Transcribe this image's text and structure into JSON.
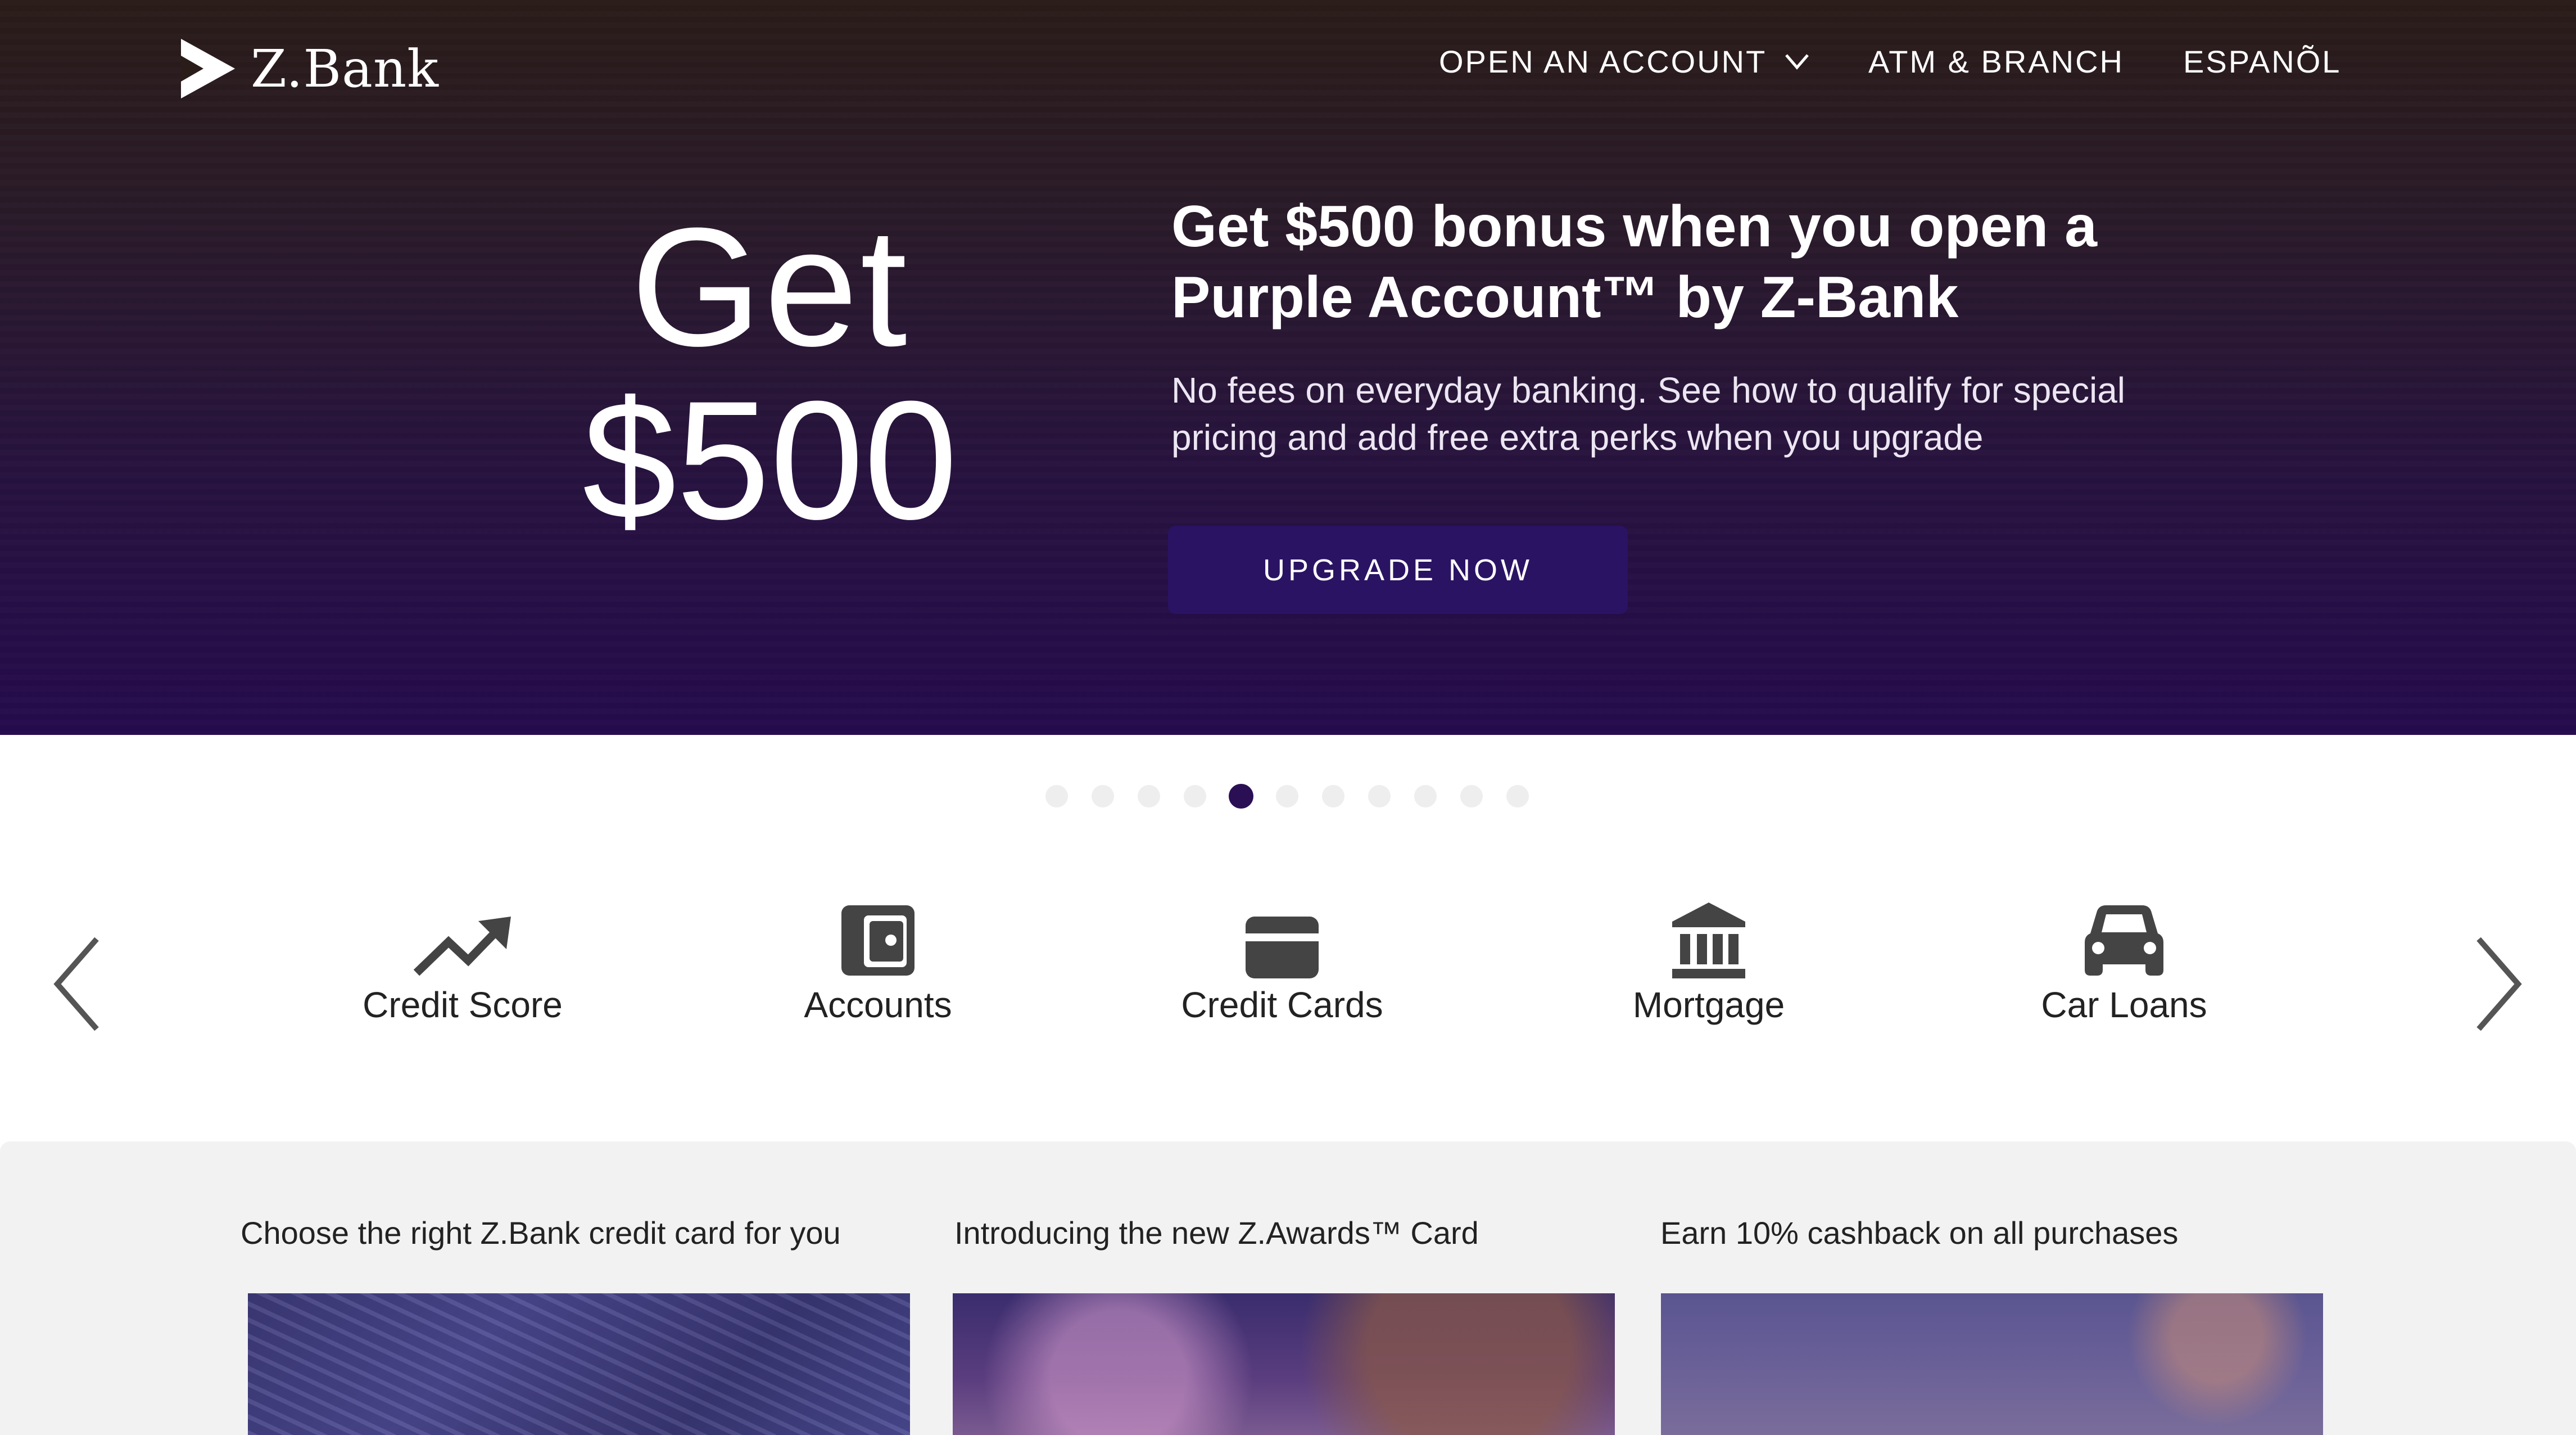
{
  "brand": {
    "name": "Z.Bank",
    "accent": "#2a1363",
    "hero_top": "#2a1c18",
    "hero_bottom": "#250b4d"
  },
  "nav": {
    "open_account": "OPEN AN ACCOUNT",
    "atm_branch": "ATM & BRANCH",
    "espanol": "ESPANÕL"
  },
  "hero": {
    "big_line1": "Get",
    "big_line2": "$500",
    "headline": "Get $500 bonus when you open a Purple Account™ by Z-Bank",
    "subtext": "No fees on everyday banking. See how to qualify for special pricing and add free extra perks when you upgrade",
    "cta": "UPGRADE NOW"
  },
  "carousel": {
    "slide_count": 11,
    "active_index": 4
  },
  "quick_links": [
    {
      "label": "Credit Score",
      "icon": "trending-up-icon"
    },
    {
      "label": "Accounts",
      "icon": "wallet-icon"
    },
    {
      "label": "Credit Cards",
      "icon": "credit-card-icon"
    },
    {
      "label": "Mortgage",
      "icon": "bank-icon"
    },
    {
      "label": "Car Loans",
      "icon": "car-icon"
    }
  ],
  "cards": [
    {
      "title": "Choose the right Z.Bank credit card for you"
    },
    {
      "title": "Introducing the new Z.Awards™ Card"
    },
    {
      "title": "Earn 10% cashback on all purchases"
    }
  ]
}
